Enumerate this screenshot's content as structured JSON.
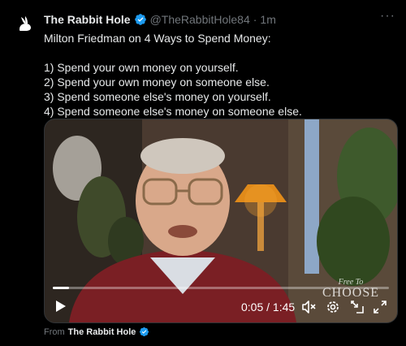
{
  "tweet": {
    "display_name": "The Rabbit Hole",
    "handle": "@TheRabbitHole84",
    "separator": "·",
    "time": "1m",
    "more_label": "···",
    "lines": [
      "Milton Friedman on 4 Ways to Spend Money:",
      "1) Spend your own money on yourself.",
      "2) Spend your own money on someone else.",
      "3) Spend someone else's money on yourself.",
      "4) Spend someone else's money on someone else."
    ]
  },
  "video": {
    "time_readout": "0:05 / 1:45",
    "progress": 0.048,
    "watermark_small": "Free To",
    "watermark_big": "CHOOSE",
    "icons": [
      "play-icon",
      "mute-icon",
      "settings-icon",
      "pip-icon",
      "fullscreen-icon"
    ]
  },
  "footer": {
    "from_label": "From",
    "from_name": "The Rabbit Hole"
  },
  "colors": {
    "background": "#000000",
    "text": "#e7e9ea",
    "muted": "#71767b",
    "verified_blue": "#1d9bf0"
  }
}
